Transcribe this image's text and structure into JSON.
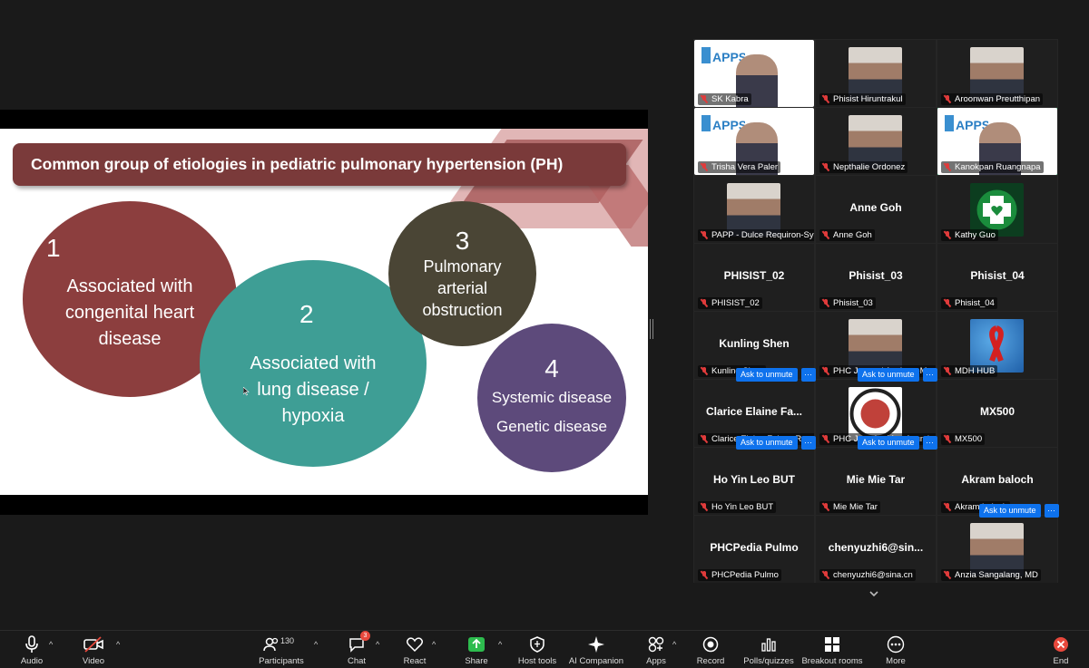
{
  "slide": {
    "title": "Common group of etiologies in pediatric pulmonary hypertension (PH)",
    "circles": [
      {
        "num": "1",
        "lines": [
          "Associated with",
          "congenital heart",
          "disease"
        ]
      },
      {
        "num": "2",
        "lines": [
          "Associated with",
          "lung disease /",
          "hypoxia"
        ]
      },
      {
        "num": "3",
        "lines": [
          "Pulmonary",
          "arterial",
          "obstruction"
        ]
      },
      {
        "num": "4",
        "lines": [
          "Systemic disease",
          "Genetic disease"
        ]
      }
    ],
    "colors": {
      "banner": "#7a3a3a",
      "c1": "#8c3e3e",
      "c2": "#3e9e95",
      "c3": "#4a4535",
      "c4": "#5d4a7b"
    }
  },
  "gallery": {
    "participants": [
      {
        "label": "SK Kabra",
        "big": "",
        "photo": "apps-logo"
      },
      {
        "label": "Phisist Hiruntrakul",
        "big": "",
        "photo": "person"
      },
      {
        "label": "Aroonwan Preutthipan",
        "big": "",
        "photo": "person"
      },
      {
        "label": "Trisha Vera Paler",
        "big": "",
        "photo": "apps-logo"
      },
      {
        "label": "Nepthalie Ordonez",
        "big": "",
        "photo": "person"
      },
      {
        "label": "Kanokpan Ruangnapa",
        "big": "",
        "photo": "apps-logo",
        "active": true
      },
      {
        "label": "PAPP - Dulce Requiron-Sy",
        "big": "",
        "photo": "person"
      },
      {
        "label": "Anne Goh",
        "big": "Anne Goh"
      },
      {
        "label": "Kathy Guo",
        "big": "",
        "photo": "green-logo"
      },
      {
        "label": "PHISIST_02",
        "big": "PHISIST_02"
      },
      {
        "label": "Phisist_03",
        "big": "Phisist_03"
      },
      {
        "label": "Phisist_04",
        "big": "Phisist_04"
      },
      {
        "label": "Kunling Shen",
        "big": "Kunling Shen"
      },
      {
        "label": "PHC Jesanel Ancheta-M...",
        "big": "",
        "photo": "person"
      },
      {
        "label": "MDH HUB",
        "big": "",
        "photo": "globe-ribbon"
      },
      {
        "label": "Clarice Elaine Falcon Ra...",
        "big": "Clarice  Elaine  Fa..."
      },
      {
        "label": "PHC Jonatha Mae Ayunti...",
        "big": "",
        "photo": "seal"
      },
      {
        "label": "MX500",
        "big": "MX500"
      },
      {
        "label": "Ho Yin Leo BUT",
        "big": "Ho Yin Leo BUT"
      },
      {
        "label": "Mie Mie Tar",
        "big": "Mie Mie Tar"
      },
      {
        "label": "Akram baloch",
        "big": "Akram baloch"
      },
      {
        "label": "PHCPedia Pulmo",
        "big": "PHCPedia Pulmo"
      },
      {
        "label": "chenyuzhi6@sina.cn",
        "big": "chenyuzhi6@sin..."
      },
      {
        "label": "Anzia Sangalang, MD",
        "big": "",
        "photo": "person"
      }
    ],
    "ask_to_unmute": "Ask to unmute",
    "more_dots": "···"
  },
  "toolbar": {
    "audio": "Audio",
    "video": "Video",
    "participants": "Participants",
    "participants_count": "130",
    "chat": "Chat",
    "chat_badge": "3",
    "react": "React",
    "share": "Share",
    "host_tools": "Host tools",
    "ai_companion": "AI Companion",
    "apps": "Apps",
    "record": "Record",
    "polls": "Polls/quizzes",
    "breakout": "Breakout rooms",
    "more": "More",
    "end": "End"
  }
}
